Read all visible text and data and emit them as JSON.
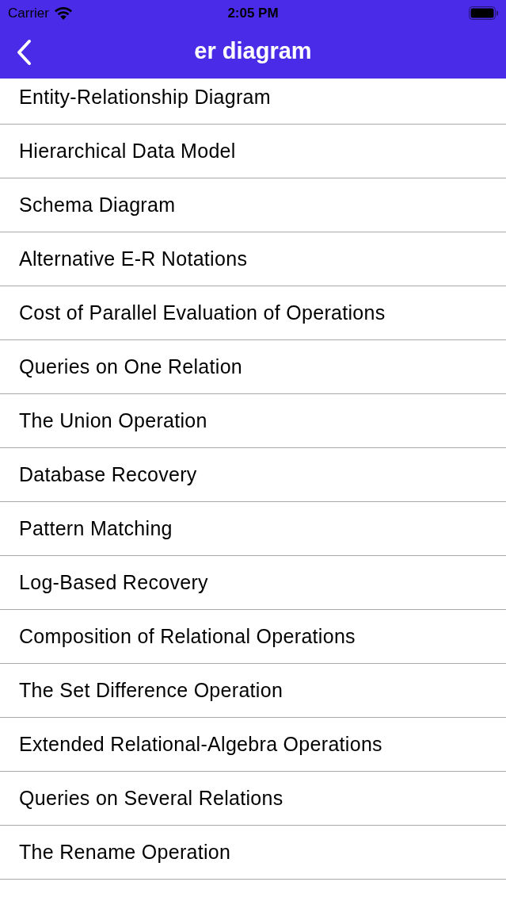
{
  "status_bar": {
    "carrier": "Carrier",
    "time": "2:05 PM"
  },
  "nav_bar": {
    "title": "er diagram"
  },
  "list": {
    "items": [
      "Entity-Relationship Diagram",
      "Hierarchical Data Model",
      "Schema Diagram",
      "Alternative E-R Notations",
      "Cost of Parallel Evaluation of Operations",
      "Queries on One Relation",
      "The Union Operation",
      "Database Recovery",
      "Pattern Matching",
      "Log-Based Recovery",
      "Composition of Relational Operations",
      "The Set Difference Operation",
      "Extended Relational-Algebra Operations",
      "Queries on Several Relations",
      "The Rename Operation"
    ]
  }
}
